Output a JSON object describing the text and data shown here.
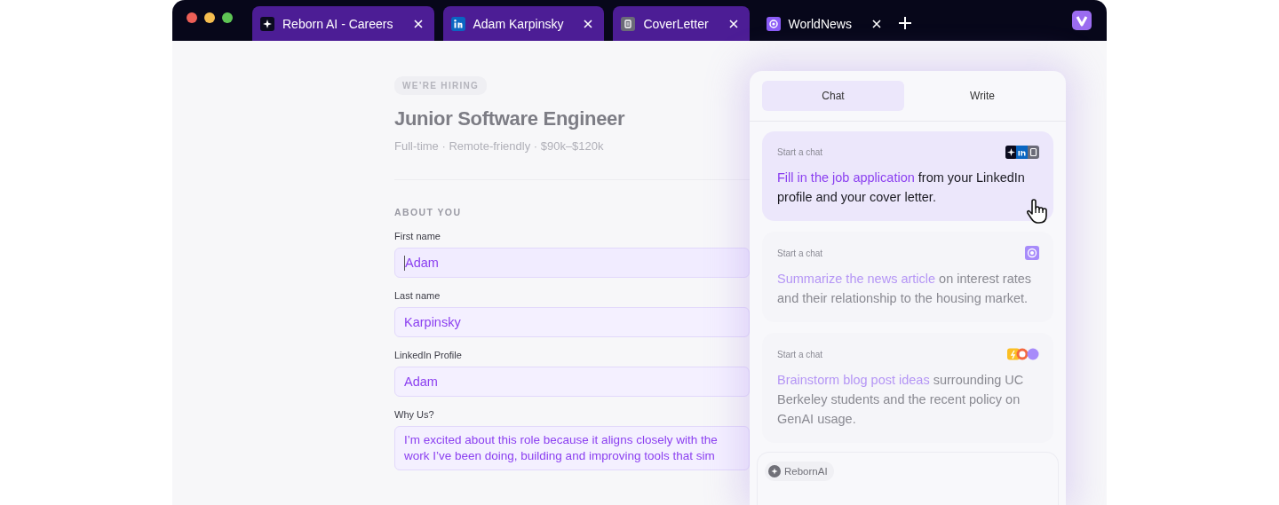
{
  "browser": {
    "tabs": [
      {
        "title": "Reborn AI - Careers",
        "selected": true
      },
      {
        "title": "Adam Karpinsky",
        "selected": true
      },
      {
        "title": "CoverLetter",
        "selected": true
      },
      {
        "title": "WorldNews",
        "selected": false
      }
    ]
  },
  "page": {
    "badge": "WE’RE HIRING",
    "title": "Junior Software Engineer",
    "meta": "Full-time · Remote-friendly · $90k–$120k",
    "section": "ABOUT YOU",
    "fields": [
      {
        "label": "First name",
        "value": "Adam",
        "focused": true,
        "kind": "input"
      },
      {
        "label": "Last name",
        "value": "Karpinsky",
        "focused": false,
        "kind": "input"
      },
      {
        "label": "LinkedIn Profile",
        "value": "Adam",
        "focused": false,
        "kind": "input"
      },
      {
        "label": "Why Us?",
        "value": "I’m excited about this role because it aligns closely with the work I’ve been doing, building and improving tools that sim",
        "focused": false,
        "kind": "textarea"
      }
    ]
  },
  "assistant": {
    "tabs": [
      {
        "label": "Chat",
        "selected": true
      },
      {
        "label": "Write",
        "selected": false
      }
    ],
    "suggestions": [
      {
        "label": "Start a chat",
        "highlight": "Fill in the job application",
        "rest": " from your LinkedIn profile and your cover letter.",
        "selected": true
      },
      {
        "label": "Start a chat",
        "highlight": "Summarize the news article",
        "rest": " on interest rates and their relationship to the housing market.",
        "selected": false
      },
      {
        "label": "Start a chat",
        "highlight": "Brainstorm blog post ideas",
        "rest": " surrounding UC Berkeley students and the recent policy on GenAI usage.",
        "selected": false
      }
    ],
    "composer": {
      "chip": "RebornAI"
    }
  }
}
